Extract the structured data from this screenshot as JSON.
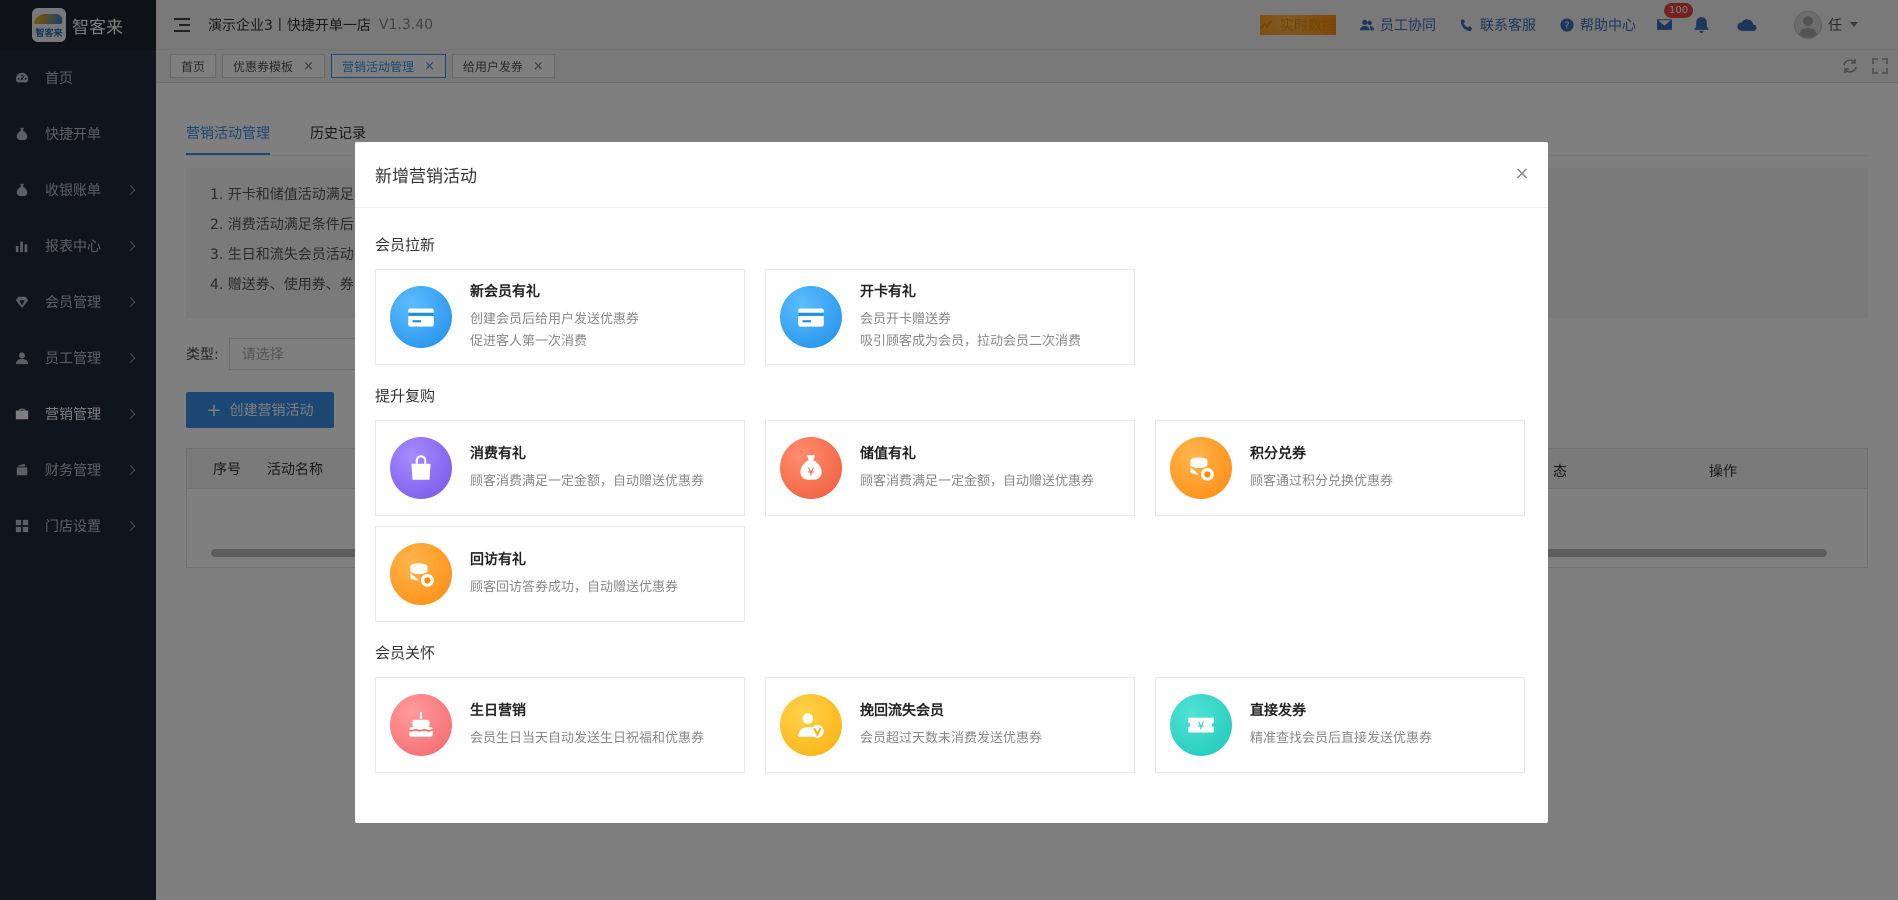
{
  "brand": {
    "name": "智客来",
    "logo_text": "智客来"
  },
  "sidebar": {
    "items": [
      {
        "label": "首页",
        "icon": "dashboard-icon",
        "has_arrow": false
      },
      {
        "label": "快捷开单",
        "icon": "money-bag-icon",
        "has_arrow": false
      },
      {
        "label": "收银账单",
        "icon": "money-bag-icon",
        "has_arrow": true
      },
      {
        "label": "报表中心",
        "icon": "bar-chart-icon",
        "has_arrow": true
      },
      {
        "label": "会员管理",
        "icon": "diamond-icon",
        "has_arrow": true
      },
      {
        "label": "员工管理",
        "icon": "user-icon",
        "has_arrow": true
      },
      {
        "label": "营销管理",
        "icon": "briefcase-icon",
        "has_arrow": true
      },
      {
        "label": "财务管理",
        "icon": "wallet-icon",
        "has_arrow": true
      },
      {
        "label": "门店设置",
        "icon": "grid-icon",
        "has_arrow": true
      }
    ]
  },
  "header": {
    "company": "演示企业3丨快捷开单一店",
    "version": "V1.3.40",
    "links": {
      "realtime": "实时数据",
      "staff": "员工协同",
      "service": "联系客服",
      "help": "帮助中心"
    },
    "mail_badge": "100",
    "user_name": "任"
  },
  "tabs": [
    {
      "label": "首页",
      "closable": false
    },
    {
      "label": "优惠券模板",
      "closable": true
    },
    {
      "label": "营销活动管理",
      "closable": true,
      "active": true
    },
    {
      "label": "给用户发券",
      "closable": true
    }
  ],
  "page": {
    "subtabs": [
      "营销活动管理",
      "历史记录"
    ],
    "notes": [
      "1. 开卡和储值活动满足",
      "2. 消费活动满足条件后",
      "3. 生日和流失会员活动",
      "4. 赠送券、使用券、券"
    ],
    "filter_label": "类型:",
    "filter_placeholder": "请选择",
    "create_button": "创建营销活动",
    "columns": {
      "no": "序号",
      "name": "活动名称",
      "status": "态",
      "actions": "操作"
    }
  },
  "modal": {
    "title": "新增营销活动",
    "close": "×",
    "sections": [
      {
        "title": "会员拉新",
        "cards": [
          {
            "title": "新会员有礼",
            "desc1": "创建会员后给用户发送优惠券",
            "desc2": "促进客人第一次消费",
            "icon": "card-icon"
          },
          {
            "title": "开卡有礼",
            "desc1": "会员开卡赠送券",
            "desc2": "吸引顾客成为会员，拉动会员二次消费",
            "icon": "card-icon"
          }
        ]
      },
      {
        "title": "提升复购",
        "cards": [
          {
            "title": "消费有礼",
            "desc1": "顾客消费满足一定金额，自动赠送优惠券",
            "desc2": "",
            "icon": "shopping-bag-icon"
          },
          {
            "title": "储值有礼",
            "desc1": "顾客消费满足一定金额，自动赠送优惠券",
            "desc2": "",
            "icon": "yuan-bag-icon"
          },
          {
            "title": "积分兑券",
            "desc1": "顾客通过积分兑换优惠券",
            "desc2": "",
            "icon": "coin-stack-icon"
          },
          {
            "title": "回访有礼",
            "desc1": "顾客回访答券成功，自动赠送优惠券",
            "desc2": "",
            "icon": "coin-stack-icon"
          }
        ]
      },
      {
        "title": "会员关怀",
        "cards": [
          {
            "title": "生日营销",
            "desc1": "会员生日当天自动发送生日祝福和优惠券",
            "desc2": "",
            "icon": "cake-icon"
          },
          {
            "title": "挽回流失会员",
            "desc1": "会员超过天数未消费发送优惠券",
            "desc2": "",
            "icon": "vip-user-icon"
          },
          {
            "title": "直接发券",
            "desc1": "精准查找会员后直接发送优惠券",
            "desc2": "",
            "icon": "ticket-icon"
          }
        ]
      }
    ]
  },
  "colors": {
    "sidebar_bg": "#1f2a3a",
    "accent": "#3a8ee6",
    "orange_link": "#e88f00"
  }
}
